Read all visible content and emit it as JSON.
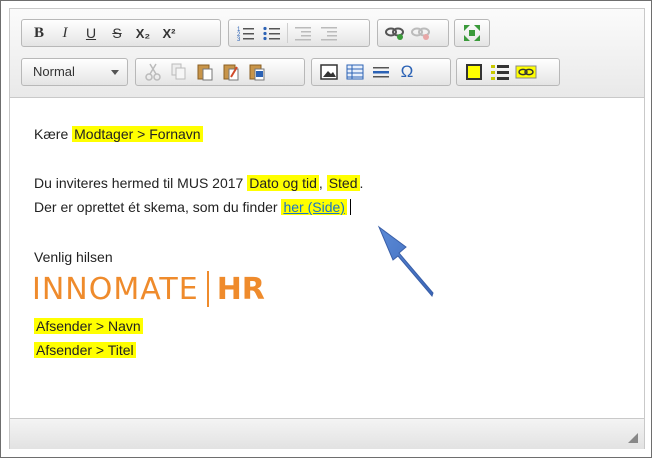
{
  "toolbar": {
    "row1": {
      "bold": "B",
      "italic": "I",
      "underline": "U",
      "strike": "S",
      "subscript": "X₂",
      "superscript": "X²"
    },
    "format_select": "Normal"
  },
  "content": {
    "greeting": "Kære",
    "recipient_field": "Modtager > Fornavn",
    "invite_text": "Du inviteres hermed til MUS 2017",
    "date_field": "Dato og tid",
    "comma": ",",
    "place_field": "Sted",
    "period": ".",
    "schema_text": "Der er oprettet ét skema, som du finder",
    "link_text": "her (Side)",
    "closing": "Venlig hilsen",
    "logo_left": "INNOMATE",
    "logo_right": "HR",
    "sender_name": "Afsender > Navn",
    "sender_title": "Afsender > Titel"
  },
  "colors": {
    "highlight": "#ffff00",
    "link": "#1a73c7",
    "logo": "#ef8b2c",
    "arrow": "#4472c4"
  }
}
